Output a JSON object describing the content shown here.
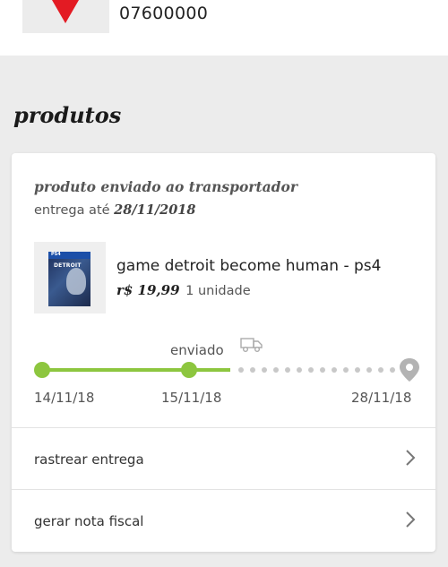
{
  "header": {
    "zip": "07600000",
    "logo_color": "#e31b23"
  },
  "products": {
    "section_title": "produtos",
    "card": {
      "status": "produto enviado ao transportador",
      "delivery_prefix": "entrega até",
      "delivery_date": "28/11/2018",
      "product": {
        "name": "game detroit become human - ps4",
        "price": "r$ 19,99",
        "quantity": "1 unidade",
        "cover_platform": "PS4",
        "cover_title": "DETROIT"
      },
      "timeline": {
        "current_label": "enviado",
        "dates": [
          "14/11/18",
          "15/11/18",
          "28/11/18"
        ],
        "progress_color": "#8dc63f",
        "pending_color": "#c8c8c8"
      },
      "actions": [
        {
          "label": "rastrear entrega"
        },
        {
          "label": "gerar nota fiscal"
        }
      ]
    }
  }
}
